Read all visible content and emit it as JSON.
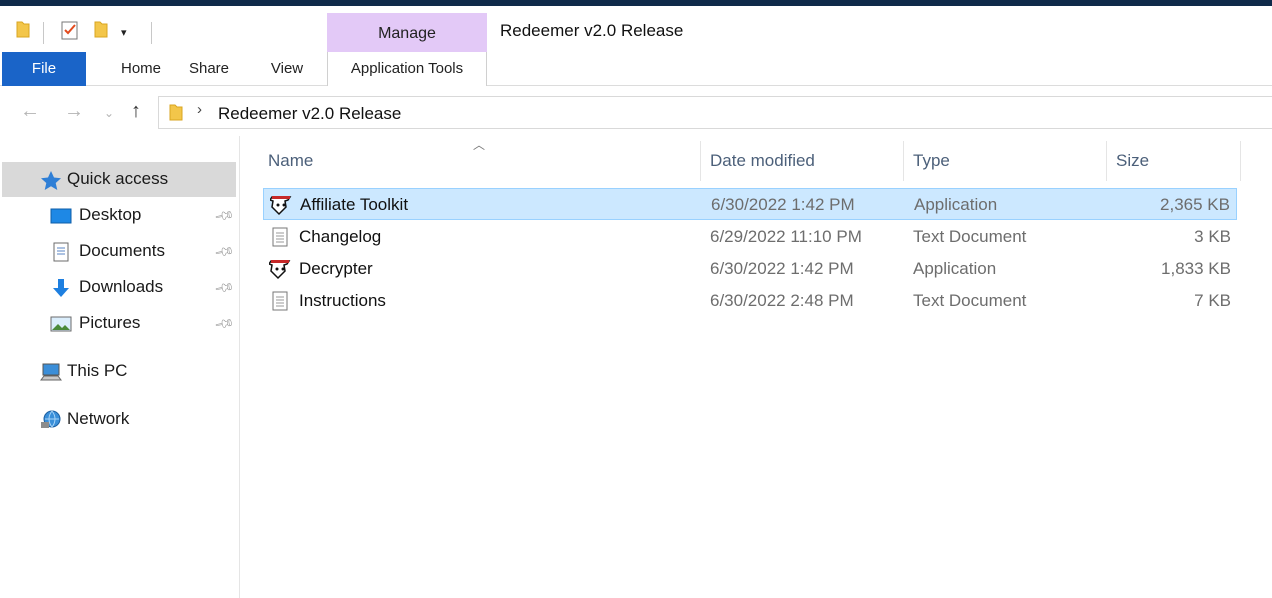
{
  "window": {
    "title": "Redeemer v2.0 Release",
    "contextual_group": "Manage"
  },
  "ribbon": {
    "tabs": [
      {
        "label": "File"
      },
      {
        "label": "Home"
      },
      {
        "label": "Share"
      },
      {
        "label": "View"
      },
      {
        "label": "Application Tools"
      }
    ]
  },
  "address": {
    "path": "Redeemer v2.0 Release"
  },
  "sidebar": {
    "quick_access": "Quick access",
    "items": [
      {
        "label": "Desktop",
        "icon": "desktop-icon",
        "pinned": true
      },
      {
        "label": "Documents",
        "icon": "documents-icon",
        "pinned": true
      },
      {
        "label": "Downloads",
        "icon": "downloads-icon",
        "pinned": true
      },
      {
        "label": "Pictures",
        "icon": "pictures-icon",
        "pinned": true
      }
    ],
    "this_pc": "This PC",
    "network": "Network"
  },
  "columns": {
    "name": "Name",
    "date": "Date modified",
    "type": "Type",
    "size": "Size"
  },
  "files": [
    {
      "name": "Affiliate Toolkit",
      "date": "6/30/2022 1:42 PM",
      "type": "Application",
      "size": "2,365 KB",
      "icon": "app-icon",
      "selected": true
    },
    {
      "name": "Changelog",
      "date": "6/29/2022 11:10 PM",
      "type": "Text Document",
      "size": "3 KB",
      "icon": "text-file-icon",
      "selected": false
    },
    {
      "name": "Decrypter",
      "date": "6/30/2022 1:42 PM",
      "type": "Application",
      "size": "1,833 KB",
      "icon": "app-icon",
      "selected": false
    },
    {
      "name": "Instructions",
      "date": "6/30/2022 2:48 PM",
      "type": "Text Document",
      "size": "7 KB",
      "icon": "text-file-icon",
      "selected": false
    }
  ],
  "colors": {
    "accent": "#1a64c8",
    "manage_tab": "#e3c9f7",
    "selection": "#cce8ff",
    "selection_border": "#99d1ff",
    "header_text": "#4c607a"
  }
}
